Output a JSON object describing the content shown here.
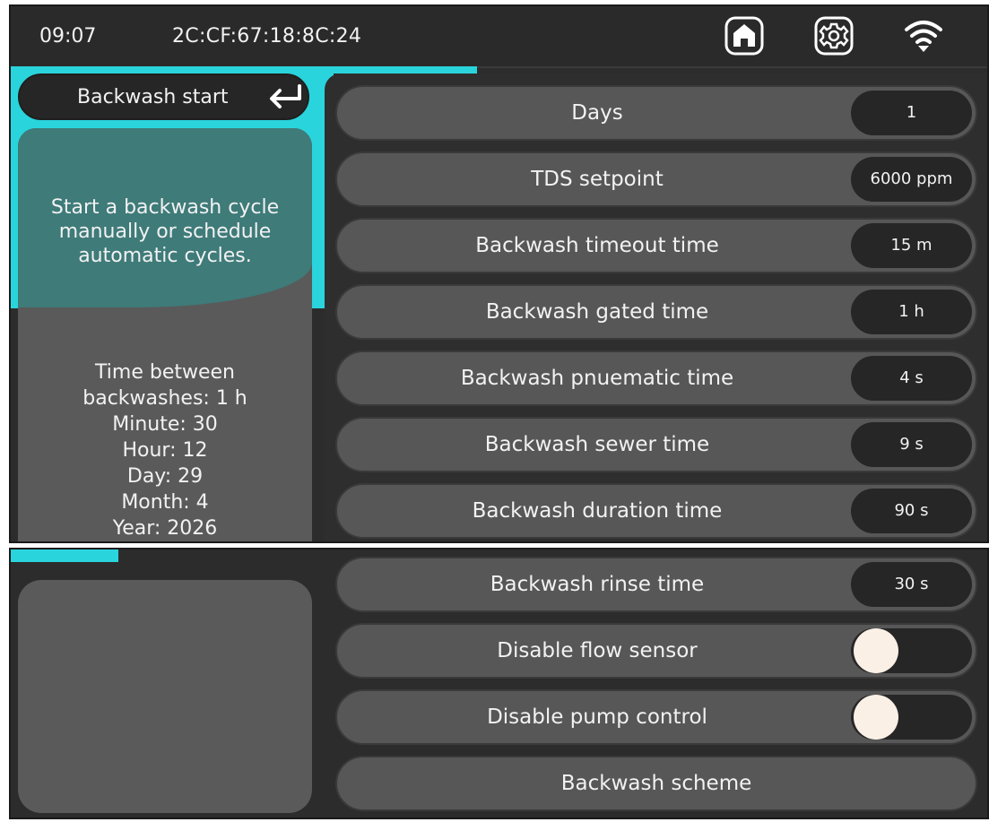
{
  "status_bar": {
    "time": "09:07",
    "mac": "2C:CF:67:18:8C:24",
    "icons": [
      "home-icon",
      "gear-icon",
      "wifi-icon"
    ]
  },
  "colors": {
    "accent": "#2ad4dc",
    "panel": "#2c2c2c",
    "row": "#575757",
    "value_pill": "#262626",
    "toggle_knob": "#fbf0e6"
  },
  "sidebar": {
    "back_label": "Backwash start",
    "description": "Start a backwash cycle\nmanually or schedule\nautomatic cycles.",
    "info": "Time between\nbackwashes: 1 h\nMinute: 30\nHour: 12\nDay: 29\nMonth: 4\nYear: 2026"
  },
  "settings": {
    "days": {
      "label": "Days",
      "value": "1"
    },
    "tds": {
      "label": "TDS setpoint",
      "value": "6000 ppm"
    },
    "timeout": {
      "label": "Backwash timeout time",
      "value": "15 m"
    },
    "gated": {
      "label": "Backwash gated time",
      "value": "1 h"
    },
    "pneumatic": {
      "label": "Backwash pnuematic time",
      "value": "4 s"
    },
    "sewer": {
      "label": "Backwash sewer time",
      "value": "9 s"
    },
    "duration": {
      "label": "Backwash duration time",
      "value": "90 s"
    },
    "rinse": {
      "label": "Backwash rinse time",
      "value": "30 s"
    },
    "flow_sensor": {
      "label": "Disable flow sensor",
      "enabled": false
    },
    "pump_control": {
      "label": "Disable pump control",
      "enabled": false
    },
    "scheme": {
      "label": "Backwash scheme"
    }
  }
}
